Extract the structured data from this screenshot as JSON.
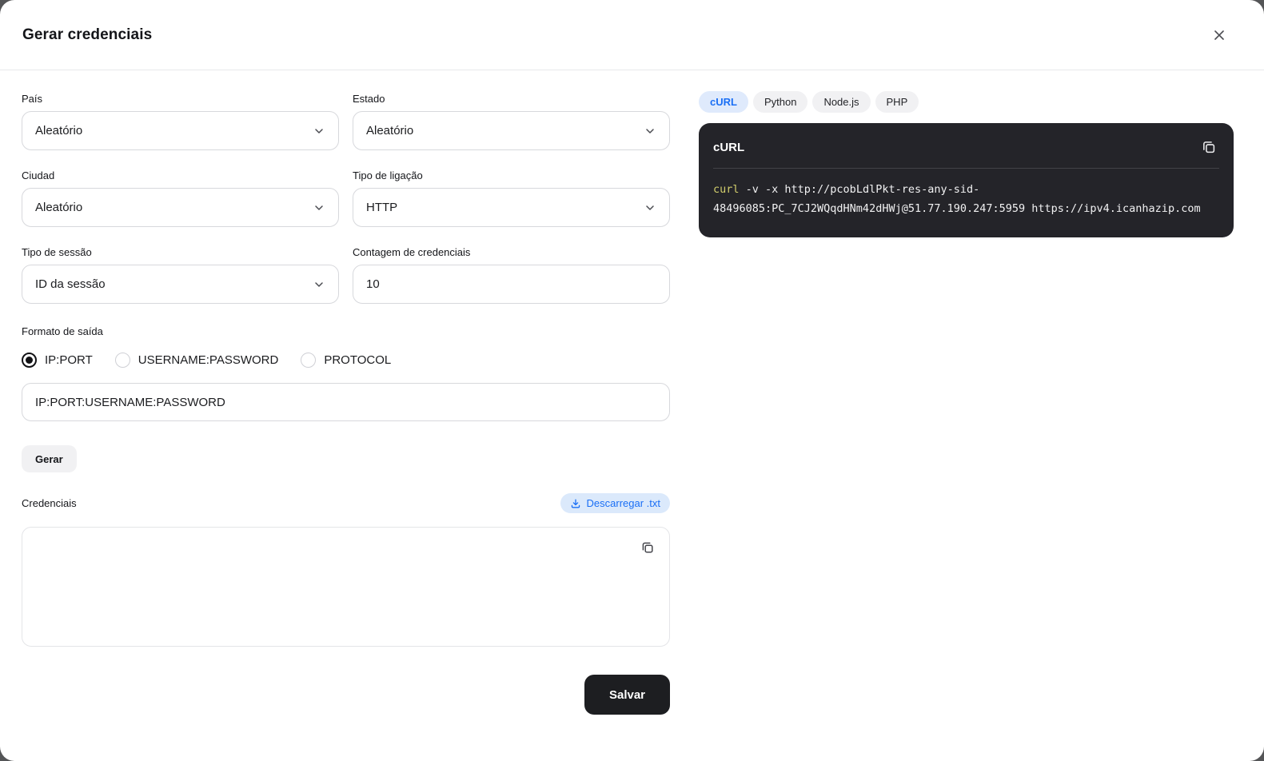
{
  "modal": {
    "title": "Gerar credenciais"
  },
  "form": {
    "fields": [
      {
        "label": "País",
        "value": "Aleatório",
        "type": "select"
      },
      {
        "label": "Estado",
        "value": "Aleatório",
        "type": "select"
      },
      {
        "label": "Ciudad",
        "value": "Aleatório",
        "type": "select"
      },
      {
        "label": "Tipo de ligação",
        "value": "HTTP",
        "type": "select"
      },
      {
        "label": "Tipo de sessão",
        "value": "ID da sessão",
        "type": "select"
      },
      {
        "label": "Contagem de credenciais",
        "value": "10",
        "type": "input"
      }
    ],
    "output_format": {
      "label": "Formato de saída",
      "options": [
        {
          "label": "IP:PORT",
          "selected": true
        },
        {
          "label": "USERNAME:PASSWORD",
          "selected": false
        },
        {
          "label": "PROTOCOL",
          "selected": false
        }
      ],
      "format_value": "IP:PORT:USERNAME:PASSWORD"
    },
    "generate_button": "Gerar",
    "credentials": {
      "label": "Credenciais",
      "download_button": "Descarregar .txt",
      "textarea_value": ""
    },
    "save_button": "Salvar"
  },
  "code_panel": {
    "tabs": [
      {
        "label": "cURL",
        "active": true
      },
      {
        "label": "Python",
        "active": false
      },
      {
        "label": "Node.js",
        "active": false
      },
      {
        "label": "PHP",
        "active": false
      }
    ],
    "block_title": "cURL",
    "code": {
      "command": "curl",
      "rest": " -v -x http://pcobLdlPkt-res-any-sid-48496085:PC_7CJ2WQqdHNm42dHWj@51.77.190.247:5959 https://ipv4.icanhazip.com"
    }
  },
  "icons": {
    "close": "close-icon",
    "chevron_down": "chevron-down-icon",
    "download": "download-icon",
    "copy": "copy-icon"
  },
  "colors": {
    "accent_blue": "#1a6ff5",
    "tab_active_bg": "#dfeafc",
    "code_block_bg": "#242429",
    "code_command": "#d2ce6c",
    "code_text": "#f1f1f2",
    "save_button_bg": "#1d1e21"
  }
}
